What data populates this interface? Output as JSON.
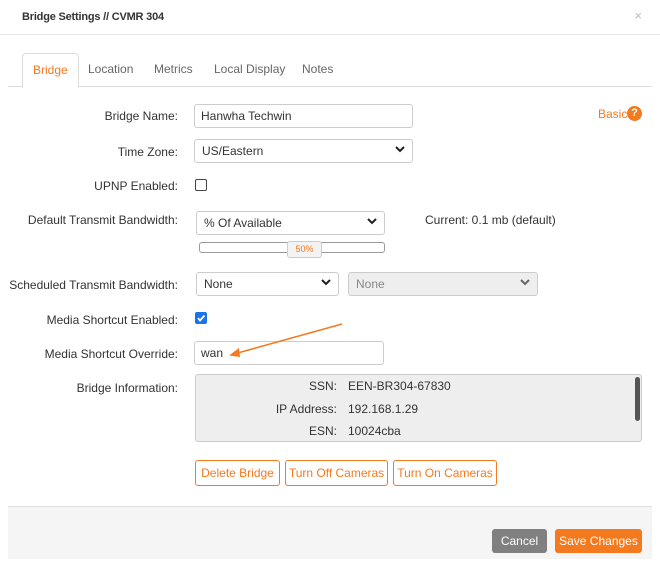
{
  "modal": {
    "title": "Bridge Settings // CVMR 304",
    "close_glyph": "×"
  },
  "tabs": [
    {
      "label": "Bridge",
      "active": true
    },
    {
      "label": "Location",
      "active": false
    },
    {
      "label": "Metrics",
      "active": false
    },
    {
      "label": "Local Display",
      "active": false
    },
    {
      "label": "Notes",
      "active": false
    }
  ],
  "basic_link": {
    "label": "Basic",
    "icon": "question-circle-icon",
    "glyph": "?"
  },
  "form": {
    "bridge_name": {
      "label": "Bridge Name:",
      "value": "Hanwha Techwin"
    },
    "time_zone": {
      "label": "Time Zone:",
      "value": "US/Eastern"
    },
    "upnp": {
      "label": "UPNP Enabled:",
      "checked": false
    },
    "default_bandwidth": {
      "label": "Default Transmit Bandwidth:",
      "value": "% Of Available",
      "current": "Current: 0.1 mb (default)",
      "slider_label": "50%",
      "slider_percent": 50
    },
    "scheduled_bandwidth": {
      "label": "Scheduled Transmit Bandwidth:",
      "value": "None",
      "secondary_value": "None"
    },
    "media_shortcut_enabled": {
      "label": "Media Shortcut Enabled:",
      "checked": true
    },
    "media_shortcut_override": {
      "label": "Media Shortcut Override:",
      "value": "wan"
    },
    "bridge_information": {
      "label": "Bridge Information:",
      "rows": [
        {
          "key": "SSN:",
          "value": "EEN-BR304-67830"
        },
        {
          "key": "IP Address:",
          "value": "192.168.1.29"
        },
        {
          "key": "ESN:",
          "value": "10024cba"
        }
      ]
    }
  },
  "actions": {
    "delete_bridge": "Delete Bridge",
    "turn_off_cameras": "Turn Off Cameras",
    "turn_on_cameras": "Turn On Cameras"
  },
  "footer": {
    "cancel": "Cancel",
    "save": "Save Changes"
  },
  "colors": {
    "accent": "#f47a20",
    "annotation_arrow": "#f47a20",
    "cancel_bg": "#808080",
    "checkbox_checked": "#1a73e8"
  }
}
